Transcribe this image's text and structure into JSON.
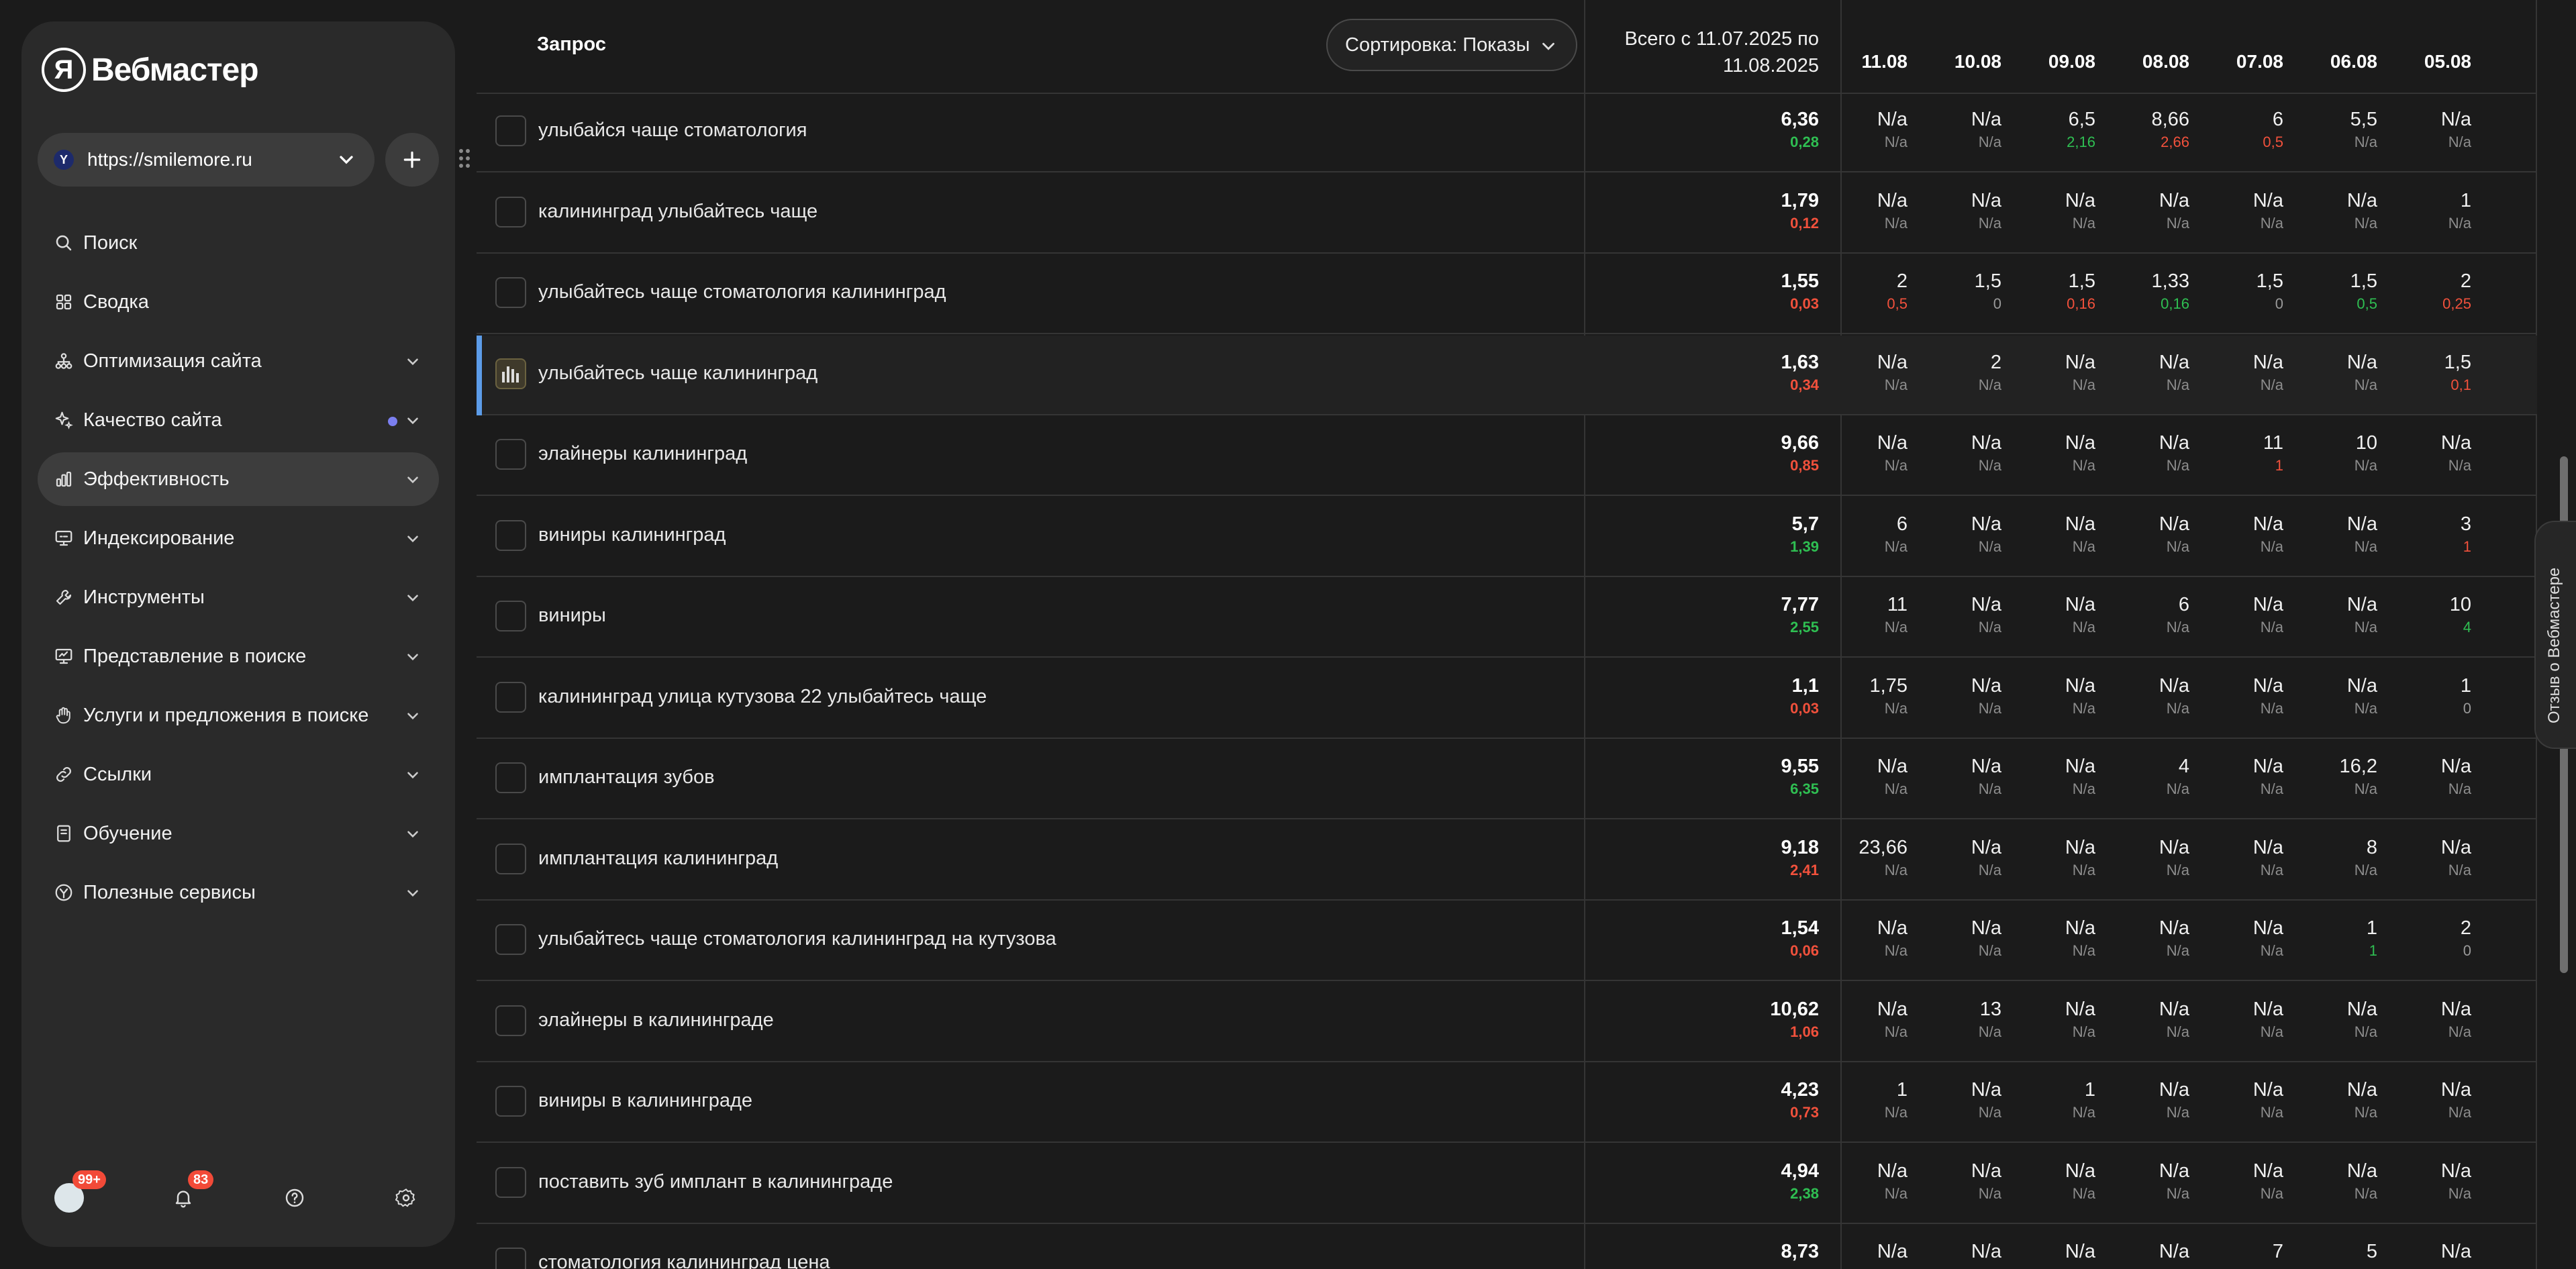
{
  "app": {
    "logo_letter": "Я",
    "logo_text": "Вебмастер"
  },
  "site": {
    "url": "https://smilemore.ru",
    "favicon": "Y"
  },
  "nav": [
    {
      "label": "Поиск",
      "icon": "search-icon",
      "chev": false
    },
    {
      "label": "Сводка",
      "icon": "grid-icon",
      "chev": false
    },
    {
      "label": "Оптимизация сайта",
      "icon": "sitemap-icon",
      "chev": true
    },
    {
      "label": "Качество сайта",
      "icon": "sparkle-icon",
      "chev": true,
      "dot": true
    },
    {
      "label": "Эффективность",
      "icon": "bar-chart-icon",
      "chev": true,
      "active": true
    },
    {
      "label": "Индексирование",
      "icon": "monitor-icon",
      "chev": true
    },
    {
      "label": "Инструменты",
      "icon": "wrench-icon",
      "chev": true
    },
    {
      "label": "Представление в поиске",
      "icon": "presentation-icon",
      "chev": true
    },
    {
      "label": "Услуги и предложения в поиске",
      "icon": "hand-icon",
      "chev": true
    },
    {
      "label": "Ссылки",
      "icon": "link-icon",
      "chev": true
    },
    {
      "label": "Обучение",
      "icon": "book-icon",
      "chev": true
    },
    {
      "label": "Полезные сервисы",
      "icon": "compass-icon",
      "chev": true
    }
  ],
  "bottom": {
    "avatar_badge": "99+",
    "notifications_badge": "83"
  },
  "table": {
    "query_header": "Запрос",
    "sort_label": "Сортировка: Показы",
    "total_header_line1": "Всего с 11.07.2025 по",
    "total_header_line2": "11.08.2025",
    "dates": [
      "11.08",
      "10.08",
      "09.08",
      "08.08",
      "07.08",
      "06.08",
      "05.08"
    ],
    "rows": [
      {
        "query": "улыбайся чаще стоматология",
        "total": "6,36",
        "delta": "0,28",
        "delta_sign": "pos",
        "cells": [
          [
            "N/a",
            "N/a",
            ""
          ],
          [
            "N/a",
            "N/a",
            ""
          ],
          [
            "6,5",
            "2,16",
            "pos"
          ],
          [
            "8,66",
            "2,66",
            "neg"
          ],
          [
            "6",
            "0,5",
            "neg"
          ],
          [
            "5,5",
            "N/a",
            ""
          ],
          [
            "N/a",
            "N/a",
            ""
          ]
        ]
      },
      {
        "query": "калининград улыбайтесь чаще",
        "total": "1,79",
        "delta": "0,12",
        "delta_sign": "neg",
        "cells": [
          [
            "N/a",
            "N/a",
            ""
          ],
          [
            "N/a",
            "N/a",
            ""
          ],
          [
            "N/a",
            "N/a",
            ""
          ],
          [
            "N/a",
            "N/a",
            ""
          ],
          [
            "N/a",
            "N/a",
            ""
          ],
          [
            "N/a",
            "N/a",
            ""
          ],
          [
            "1",
            "N/a",
            ""
          ]
        ]
      },
      {
        "query": "улыбайтесь чаще стоматология калининград",
        "total": "1,55",
        "delta": "0,03",
        "delta_sign": "neg",
        "cells": [
          [
            "2",
            "0,5",
            "neg"
          ],
          [
            "1,5",
            "0",
            "zero"
          ],
          [
            "1,5",
            "0,16",
            "neg"
          ],
          [
            "1,33",
            "0,16",
            "pos"
          ],
          [
            "1,5",
            "0",
            "zero"
          ],
          [
            "1,5",
            "0,5",
            "pos"
          ],
          [
            "2",
            "0,25",
            "neg"
          ]
        ]
      },
      {
        "query": "улыбайтесь чаще калининград",
        "total": "1,63",
        "delta": "0,34",
        "delta_sign": "neg",
        "highlight": true,
        "cells": [
          [
            "N/a",
            "N/a",
            ""
          ],
          [
            "2",
            "N/a",
            ""
          ],
          [
            "N/a",
            "N/a",
            ""
          ],
          [
            "N/a",
            "N/a",
            ""
          ],
          [
            "N/a",
            "N/a",
            ""
          ],
          [
            "N/a",
            "N/a",
            ""
          ],
          [
            "1,5",
            "0,1",
            "neg"
          ]
        ]
      },
      {
        "query": "элайнеры калининград",
        "total": "9,66",
        "delta": "0,85",
        "delta_sign": "neg",
        "cells": [
          [
            "N/a",
            "N/a",
            ""
          ],
          [
            "N/a",
            "N/a",
            ""
          ],
          [
            "N/a",
            "N/a",
            ""
          ],
          [
            "N/a",
            "N/a",
            ""
          ],
          [
            "11",
            "1",
            "neg"
          ],
          [
            "10",
            "N/a",
            ""
          ],
          [
            "N/a",
            "N/a",
            ""
          ]
        ]
      },
      {
        "query": "виниры калининград",
        "total": "5,7",
        "delta": "1,39",
        "delta_sign": "pos",
        "cells": [
          [
            "6",
            "N/a",
            ""
          ],
          [
            "N/a",
            "N/a",
            ""
          ],
          [
            "N/a",
            "N/a",
            ""
          ],
          [
            "N/a",
            "N/a",
            ""
          ],
          [
            "N/a",
            "N/a",
            ""
          ],
          [
            "N/a",
            "N/a",
            ""
          ],
          [
            "3",
            "1",
            "neg"
          ]
        ]
      },
      {
        "query": "виниры",
        "total": "7,77",
        "delta": "2,55",
        "delta_sign": "pos",
        "cells": [
          [
            "11",
            "N/a",
            ""
          ],
          [
            "N/a",
            "N/a",
            ""
          ],
          [
            "N/a",
            "N/a",
            ""
          ],
          [
            "6",
            "N/a",
            ""
          ],
          [
            "N/a",
            "N/a",
            ""
          ],
          [
            "N/a",
            "N/a",
            ""
          ],
          [
            "10",
            "4",
            "pos"
          ]
        ]
      },
      {
        "query": "калининград улица кутузова 22 улыбайтесь чаще",
        "total": "1,1",
        "delta": "0,03",
        "delta_sign": "neg",
        "cells": [
          [
            "1,75",
            "N/a",
            ""
          ],
          [
            "N/a",
            "N/a",
            ""
          ],
          [
            "N/a",
            "N/a",
            ""
          ],
          [
            "N/a",
            "N/a",
            ""
          ],
          [
            "N/a",
            "N/a",
            ""
          ],
          [
            "N/a",
            "N/a",
            ""
          ],
          [
            "1",
            "0",
            "zero"
          ]
        ]
      },
      {
        "query": "имплантация зубов",
        "total": "9,55",
        "delta": "6,35",
        "delta_sign": "pos",
        "cells": [
          [
            "N/a",
            "N/a",
            ""
          ],
          [
            "N/a",
            "N/a",
            ""
          ],
          [
            "N/a",
            "N/a",
            ""
          ],
          [
            "4",
            "N/a",
            ""
          ],
          [
            "N/a",
            "N/a",
            ""
          ],
          [
            "16,2",
            "N/a",
            ""
          ],
          [
            "N/a",
            "N/a",
            ""
          ]
        ]
      },
      {
        "query": "имплантация калининград",
        "total": "9,18",
        "delta": "2,41",
        "delta_sign": "neg",
        "cells": [
          [
            "23,66",
            "N/a",
            ""
          ],
          [
            "N/a",
            "N/a",
            ""
          ],
          [
            "N/a",
            "N/a",
            ""
          ],
          [
            "N/a",
            "N/a",
            ""
          ],
          [
            "N/a",
            "N/a",
            ""
          ],
          [
            "8",
            "N/a",
            ""
          ],
          [
            "N/a",
            "N/a",
            ""
          ]
        ]
      },
      {
        "query": "улыбайтесь чаще стоматология калининград на кутузова",
        "total": "1,54",
        "delta": "0,06",
        "delta_sign": "neg",
        "cells": [
          [
            "N/a",
            "N/a",
            ""
          ],
          [
            "N/a",
            "N/a",
            ""
          ],
          [
            "N/a",
            "N/a",
            ""
          ],
          [
            "N/a",
            "N/a",
            ""
          ],
          [
            "N/a",
            "N/a",
            ""
          ],
          [
            "1",
            "1",
            "pos"
          ],
          [
            "2",
            "0",
            "zero"
          ]
        ]
      },
      {
        "query": "элайнеры в калининграде",
        "total": "10,62",
        "delta": "1,06",
        "delta_sign": "neg",
        "cells": [
          [
            "N/a",
            "N/a",
            ""
          ],
          [
            "13",
            "N/a",
            ""
          ],
          [
            "N/a",
            "N/a",
            ""
          ],
          [
            "N/a",
            "N/a",
            ""
          ],
          [
            "N/a",
            "N/a",
            ""
          ],
          [
            "N/a",
            "N/a",
            ""
          ],
          [
            "N/a",
            "N/a",
            ""
          ]
        ]
      },
      {
        "query": "виниры в калининграде",
        "total": "4,23",
        "delta": "0,73",
        "delta_sign": "neg",
        "cells": [
          [
            "1",
            "N/a",
            ""
          ],
          [
            "N/a",
            "N/a",
            ""
          ],
          [
            "1",
            "N/a",
            ""
          ],
          [
            "N/a",
            "N/a",
            ""
          ],
          [
            "N/a",
            "N/a",
            ""
          ],
          [
            "N/a",
            "N/a",
            ""
          ],
          [
            "N/a",
            "N/a",
            ""
          ]
        ]
      },
      {
        "query": "поставить зуб имплант в калининграде",
        "total": "4,94",
        "delta": "2,38",
        "delta_sign": "pos",
        "cells": [
          [
            "N/a",
            "N/a",
            ""
          ],
          [
            "N/a",
            "N/a",
            ""
          ],
          [
            "N/a",
            "N/a",
            ""
          ],
          [
            "N/a",
            "N/a",
            ""
          ],
          [
            "N/a",
            "N/a",
            ""
          ],
          [
            "N/a",
            "N/a",
            ""
          ],
          [
            "N/a",
            "N/a",
            ""
          ]
        ]
      },
      {
        "query": "стоматология калининград цена",
        "total": "8,73",
        "delta": "",
        "delta_sign": "",
        "cells": [
          [
            "N/a",
            "",
            ""
          ],
          [
            "N/a",
            "",
            ""
          ],
          [
            "N/a",
            "",
            ""
          ],
          [
            "N/a",
            "",
            ""
          ],
          [
            "7",
            "",
            ""
          ],
          [
            "5",
            "",
            ""
          ],
          [
            "N/a",
            "",
            ""
          ]
        ]
      }
    ]
  },
  "feedback_tab": "Отзыв о Вебмастере"
}
